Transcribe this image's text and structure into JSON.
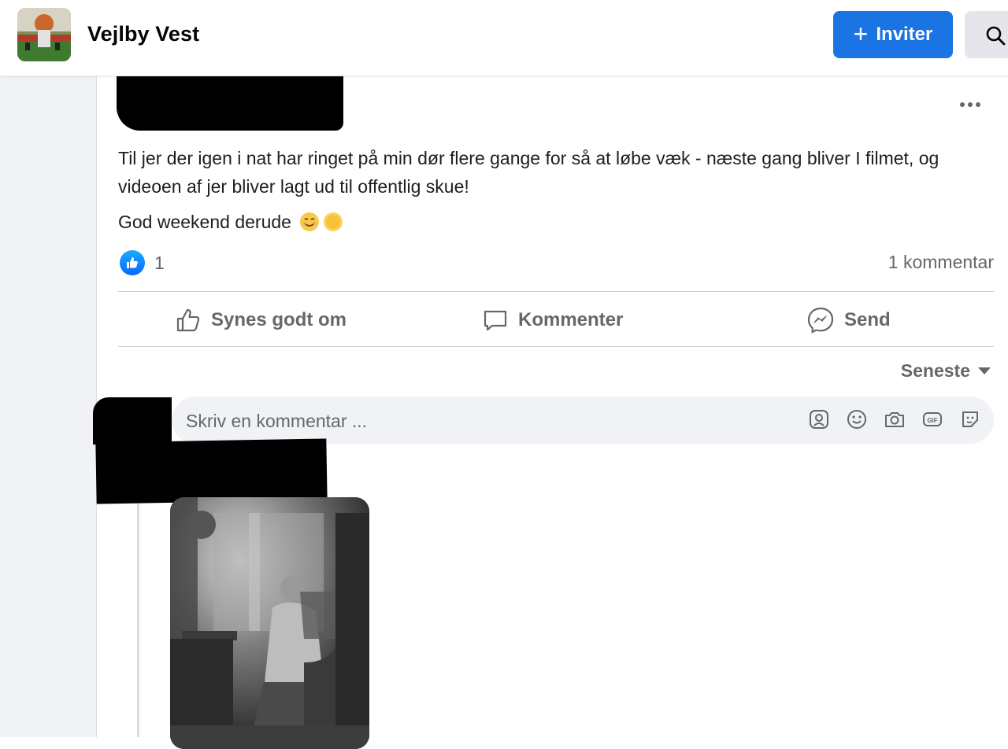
{
  "header": {
    "group_name": "Vejlby Vest",
    "invite_label": "Inviter",
    "invite_icon": "plus-icon",
    "search_icon": "search-icon",
    "accent_color": "#1b74e4"
  },
  "post": {
    "text_line1": "Til jer der igen i nat har ringet på min dør flere gange for så at løbe væk - næste gang bliver I filmet, og videoen af jer bliver lagt ud til offentlig skue!",
    "text_line2": "God weekend derude",
    "emojis": [
      "smiling-face-icon",
      "sun-icon"
    ],
    "like_count": "1",
    "comment_count_label": "1 kommentar",
    "actions": {
      "like": "Synes godt om",
      "comment": "Kommenter",
      "send": "Send"
    }
  },
  "comments": {
    "sort_label": "Seneste",
    "input_placeholder": "Skriv en kommentar ...",
    "input_icons": [
      "avatar-sticker-icon",
      "emoji-icon",
      "camera-icon",
      "gif-icon",
      "sticker-icon"
    ]
  }
}
